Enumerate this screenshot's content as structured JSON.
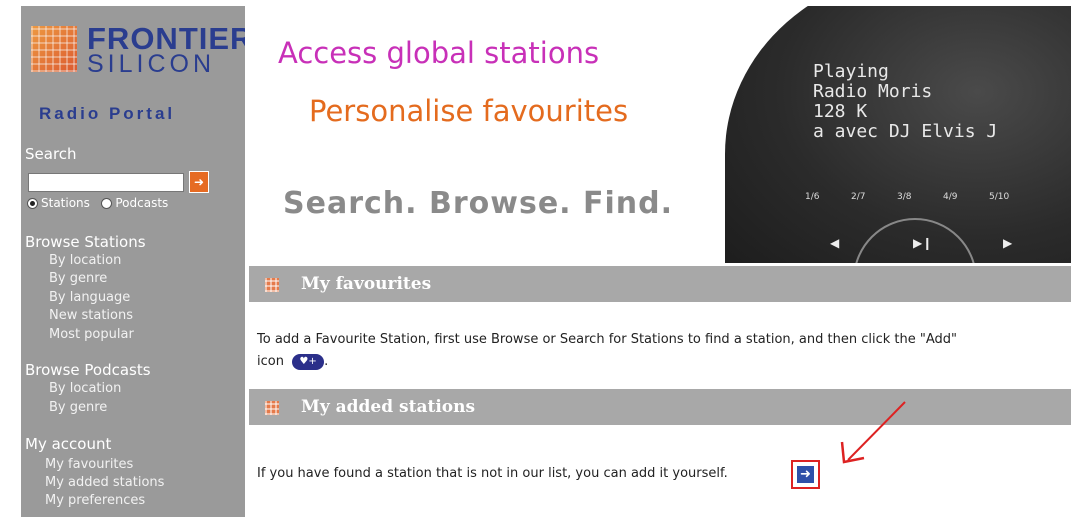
{
  "brand": {
    "name": "FRONTIER",
    "sub": "SILICON",
    "portal": "Radio Portal"
  },
  "sidebar": {
    "search_heading": "Search",
    "search_placeholder": "",
    "search_go_icon": "arrow-right-icon",
    "radio_stations": "Stations",
    "radio_podcasts": "Podcasts",
    "browse_stations_heading": "Browse Stations",
    "browse_stations": [
      "By location",
      "By genre",
      "By language",
      "New stations",
      "Most popular"
    ],
    "browse_podcasts_heading": "Browse Podcasts",
    "browse_podcasts": [
      "By location",
      "By genre"
    ],
    "account_heading": "My account",
    "account_links": [
      "My favourites",
      "My added stations",
      "My preferences"
    ]
  },
  "banner": {
    "tag1": "Access global stations",
    "tag2": "Personalise favourites",
    "tag3": "Search. Browse. Find.",
    "display_line1": "Playing",
    "display_line2": "Radio Moris",
    "display_line3": "128 K",
    "display_line4": "a avec DJ Elvis J",
    "presets": [
      "1/6",
      "2/7",
      "3/8",
      "4/9",
      "5/10"
    ]
  },
  "favourites": {
    "title": "My favourites",
    "text_before": "To add a Favourite Station, first use Browse or Search for Stations to find a station, and then   click the \"Add\"",
    "text_icon_prefix": "icon",
    "add_icon_label": "♥+",
    "text_after": "."
  },
  "added": {
    "title": "My added stations",
    "text": "If you have found a station that is not in our list, you can add it yourself."
  },
  "colors": {
    "sidebar": "#9a9a9a",
    "brand": "#2a3d8f",
    "bar": "#a8a8a8",
    "tag1": "#c830b8",
    "tag2": "#e46b1e",
    "highlight": "#dd2222"
  }
}
